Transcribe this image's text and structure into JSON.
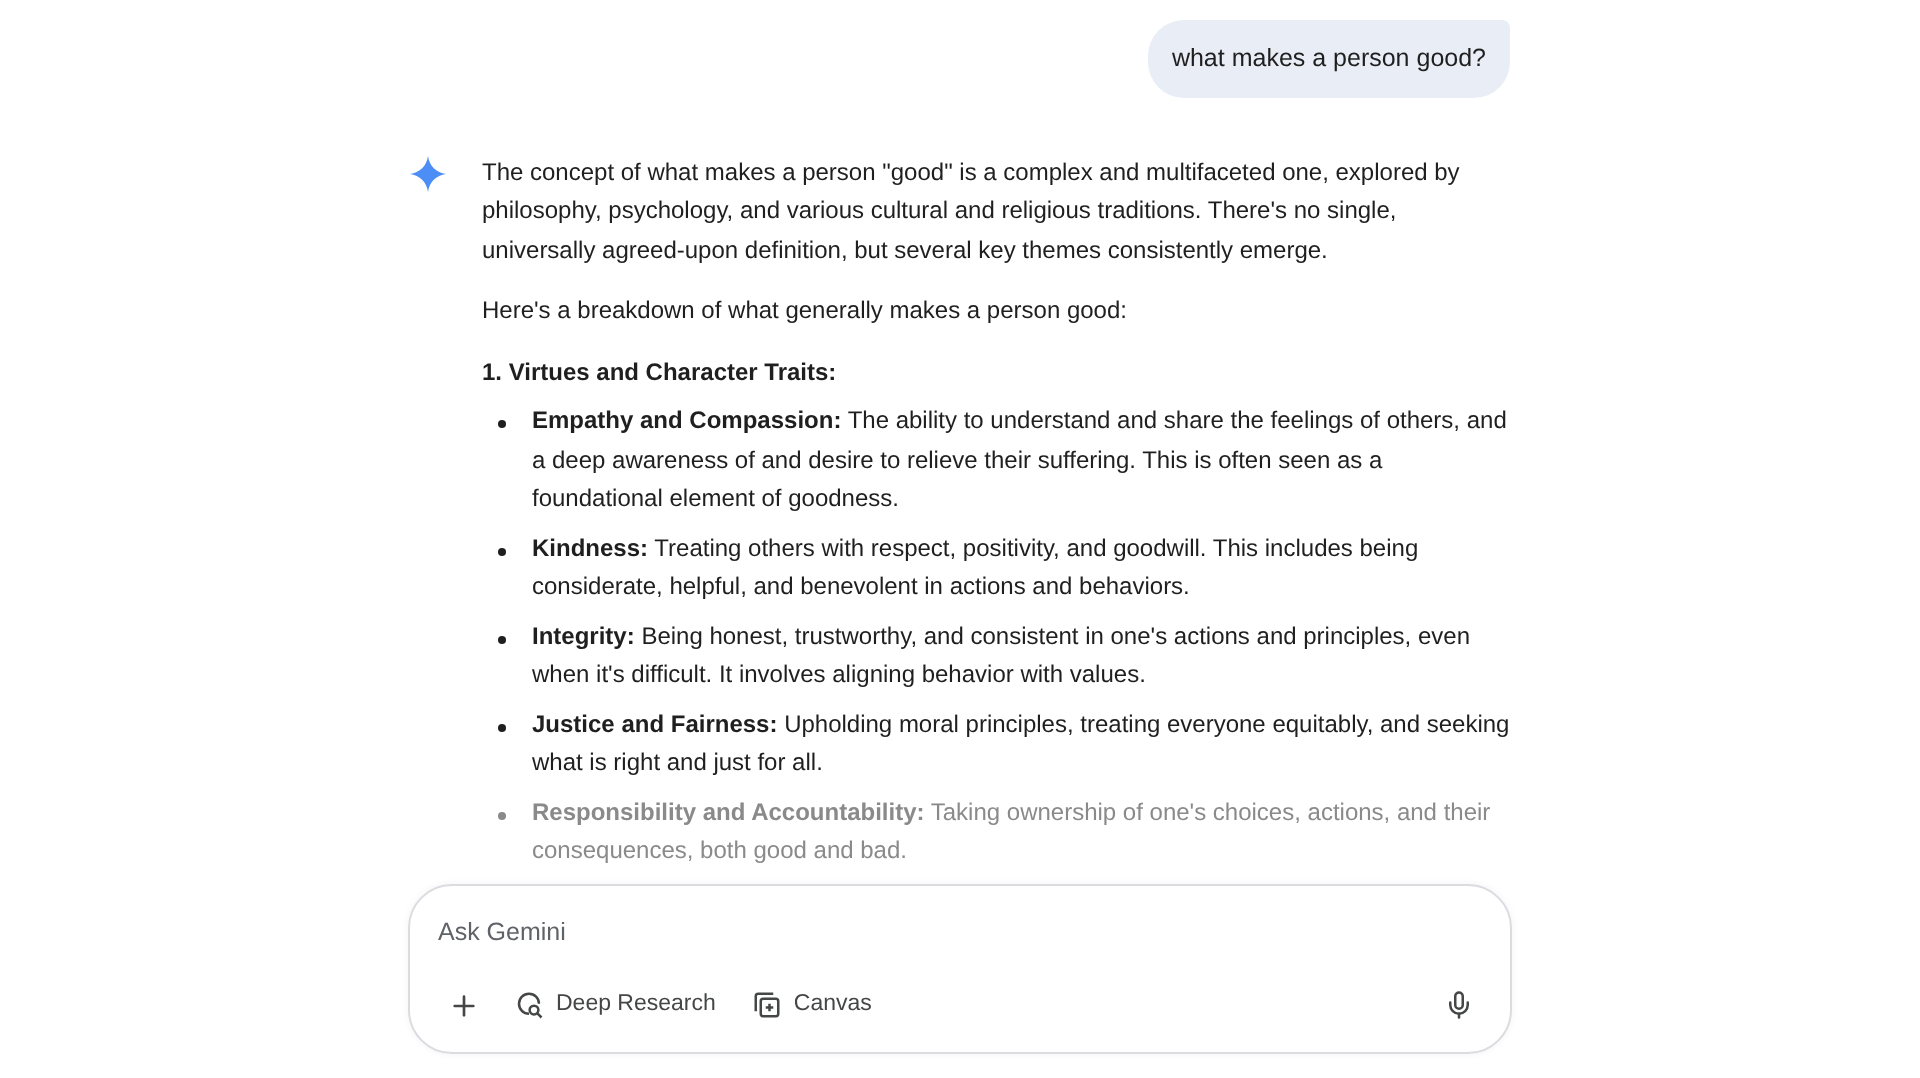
{
  "user_message": "what makes a person good?",
  "response": {
    "intro": "The concept of what makes a person \"good\" is a complex and multifaceted one, explored by philosophy, psychology, and various cultural and religious traditions. There's no single, universally agreed-upon definition, but several key themes consistently emerge.",
    "lead": "Here's a breakdown of what generally makes a person good:",
    "section_heading": "1. Virtues and Character Traits:",
    "bullets": [
      {
        "term": "Empathy and Compassion:",
        "text": "The ability to understand and share the feelings of others, and a deep awareness of and desire to relieve their suffering. This is often seen as a foundational element of goodness.",
        "faded": false
      },
      {
        "term": "Kindness:",
        "text": "Treating others with respect, positivity, and goodwill. This includes being considerate, helpful, and benevolent in actions and behaviors.",
        "faded": false
      },
      {
        "term": "Integrity:",
        "text": "Being honest, trustworthy, and consistent in one's actions and principles, even when it's difficult. It involves aligning behavior with values.",
        "faded": false
      },
      {
        "term": "Justice and Fairness:",
        "text": "Upholding moral principles, treating everyone equitably, and seeking what is right and just for all.",
        "faded": false
      },
      {
        "term": "Responsibility and Accountability:",
        "text": "Taking ownership of one's choices, actions, and their consequences, both good and bad.",
        "faded": true
      }
    ]
  },
  "composer": {
    "placeholder": "Ask Gemini",
    "tools": [
      {
        "kind": "plus"
      },
      {
        "kind": "deep_research",
        "label": "Deep Research"
      },
      {
        "kind": "canvas",
        "label": "Canvas"
      }
    ]
  }
}
